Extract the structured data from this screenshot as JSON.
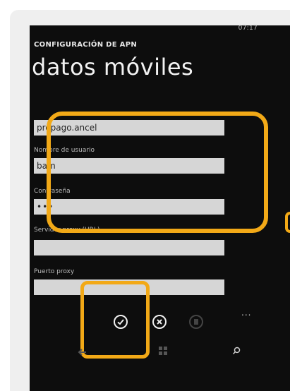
{
  "status": {
    "time": "07:17"
  },
  "page": {
    "heading": "CONFIGURACIÓN DE APN",
    "title": "datos móviles"
  },
  "fields": {
    "apn_value": "prepago.ancel",
    "username_label": "Nombre de usuario",
    "username_value": "bam",
    "password_label": "Contraseña",
    "password_value": "•••",
    "proxy_server_label": "Servidor proxy (URL)",
    "proxy_server_value": "",
    "proxy_port_label": "Puerto proxy",
    "proxy_port_value": ""
  },
  "appbar": {
    "save_icon": "check-icon",
    "cancel_icon": "close-icon",
    "disabled_icon": "delete-icon",
    "more": "..."
  },
  "navbar": {
    "back_icon": "back-arrow-icon",
    "start_icon": "windows-logo-icon",
    "search_icon": "search-icon"
  },
  "colors": {
    "highlight": "#f2a917",
    "screen": "#0d0d0d",
    "field": "#d6d6d6"
  }
}
